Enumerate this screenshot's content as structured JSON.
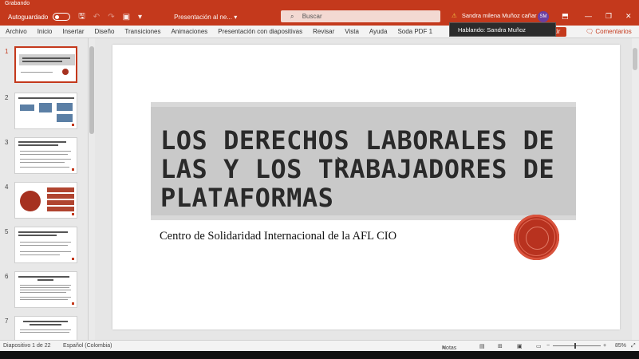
{
  "recording": {
    "label": "Grabando"
  },
  "titlebar": {
    "autosave_label": "Autoguardado",
    "doc_title": "Presentación al ne... ▾",
    "search_placeholder": "Buscar",
    "user_name": "Sandra milena Muñoz cañar",
    "avatar_initials": "SM"
  },
  "ribbon": {
    "tabs": [
      "Archivo",
      "Inicio",
      "Insertar",
      "Diseño",
      "Transiciones",
      "Animaciones",
      "Presentación con diapositivas",
      "Revisar",
      "Vista",
      "Ayuda",
      "Soda PDF 1"
    ],
    "share_label": "partir",
    "comments_label": "Comentarios"
  },
  "tooltip": {
    "text": "Hablando: Sandra Muñoz"
  },
  "thumbnails": {
    "items": [
      {
        "num": "1",
        "selected": true
      },
      {
        "num": "2",
        "selected": false
      },
      {
        "num": "3",
        "selected": false
      },
      {
        "num": "4",
        "selected": false
      },
      {
        "num": "5",
        "selected": false
      },
      {
        "num": "6",
        "selected": false
      },
      {
        "num": "7",
        "selected": false
      }
    ]
  },
  "slide": {
    "title": "LOS DERECHOS LABORALES DE LAS Y LOS TRABAJADORES DE PLATAFORMAS",
    "subtitle": "Centro de Solidaridad Internacional de la AFL CIO"
  },
  "statusbar": {
    "slide_counter": "Diapositivo 1 de 22",
    "language": "Español (Colombia)",
    "notes_label": "Notas",
    "zoom": "85%"
  },
  "colors": {
    "accent": "#c4391c",
    "title_band": "#c9c9c9",
    "seal": "#b8321f"
  }
}
